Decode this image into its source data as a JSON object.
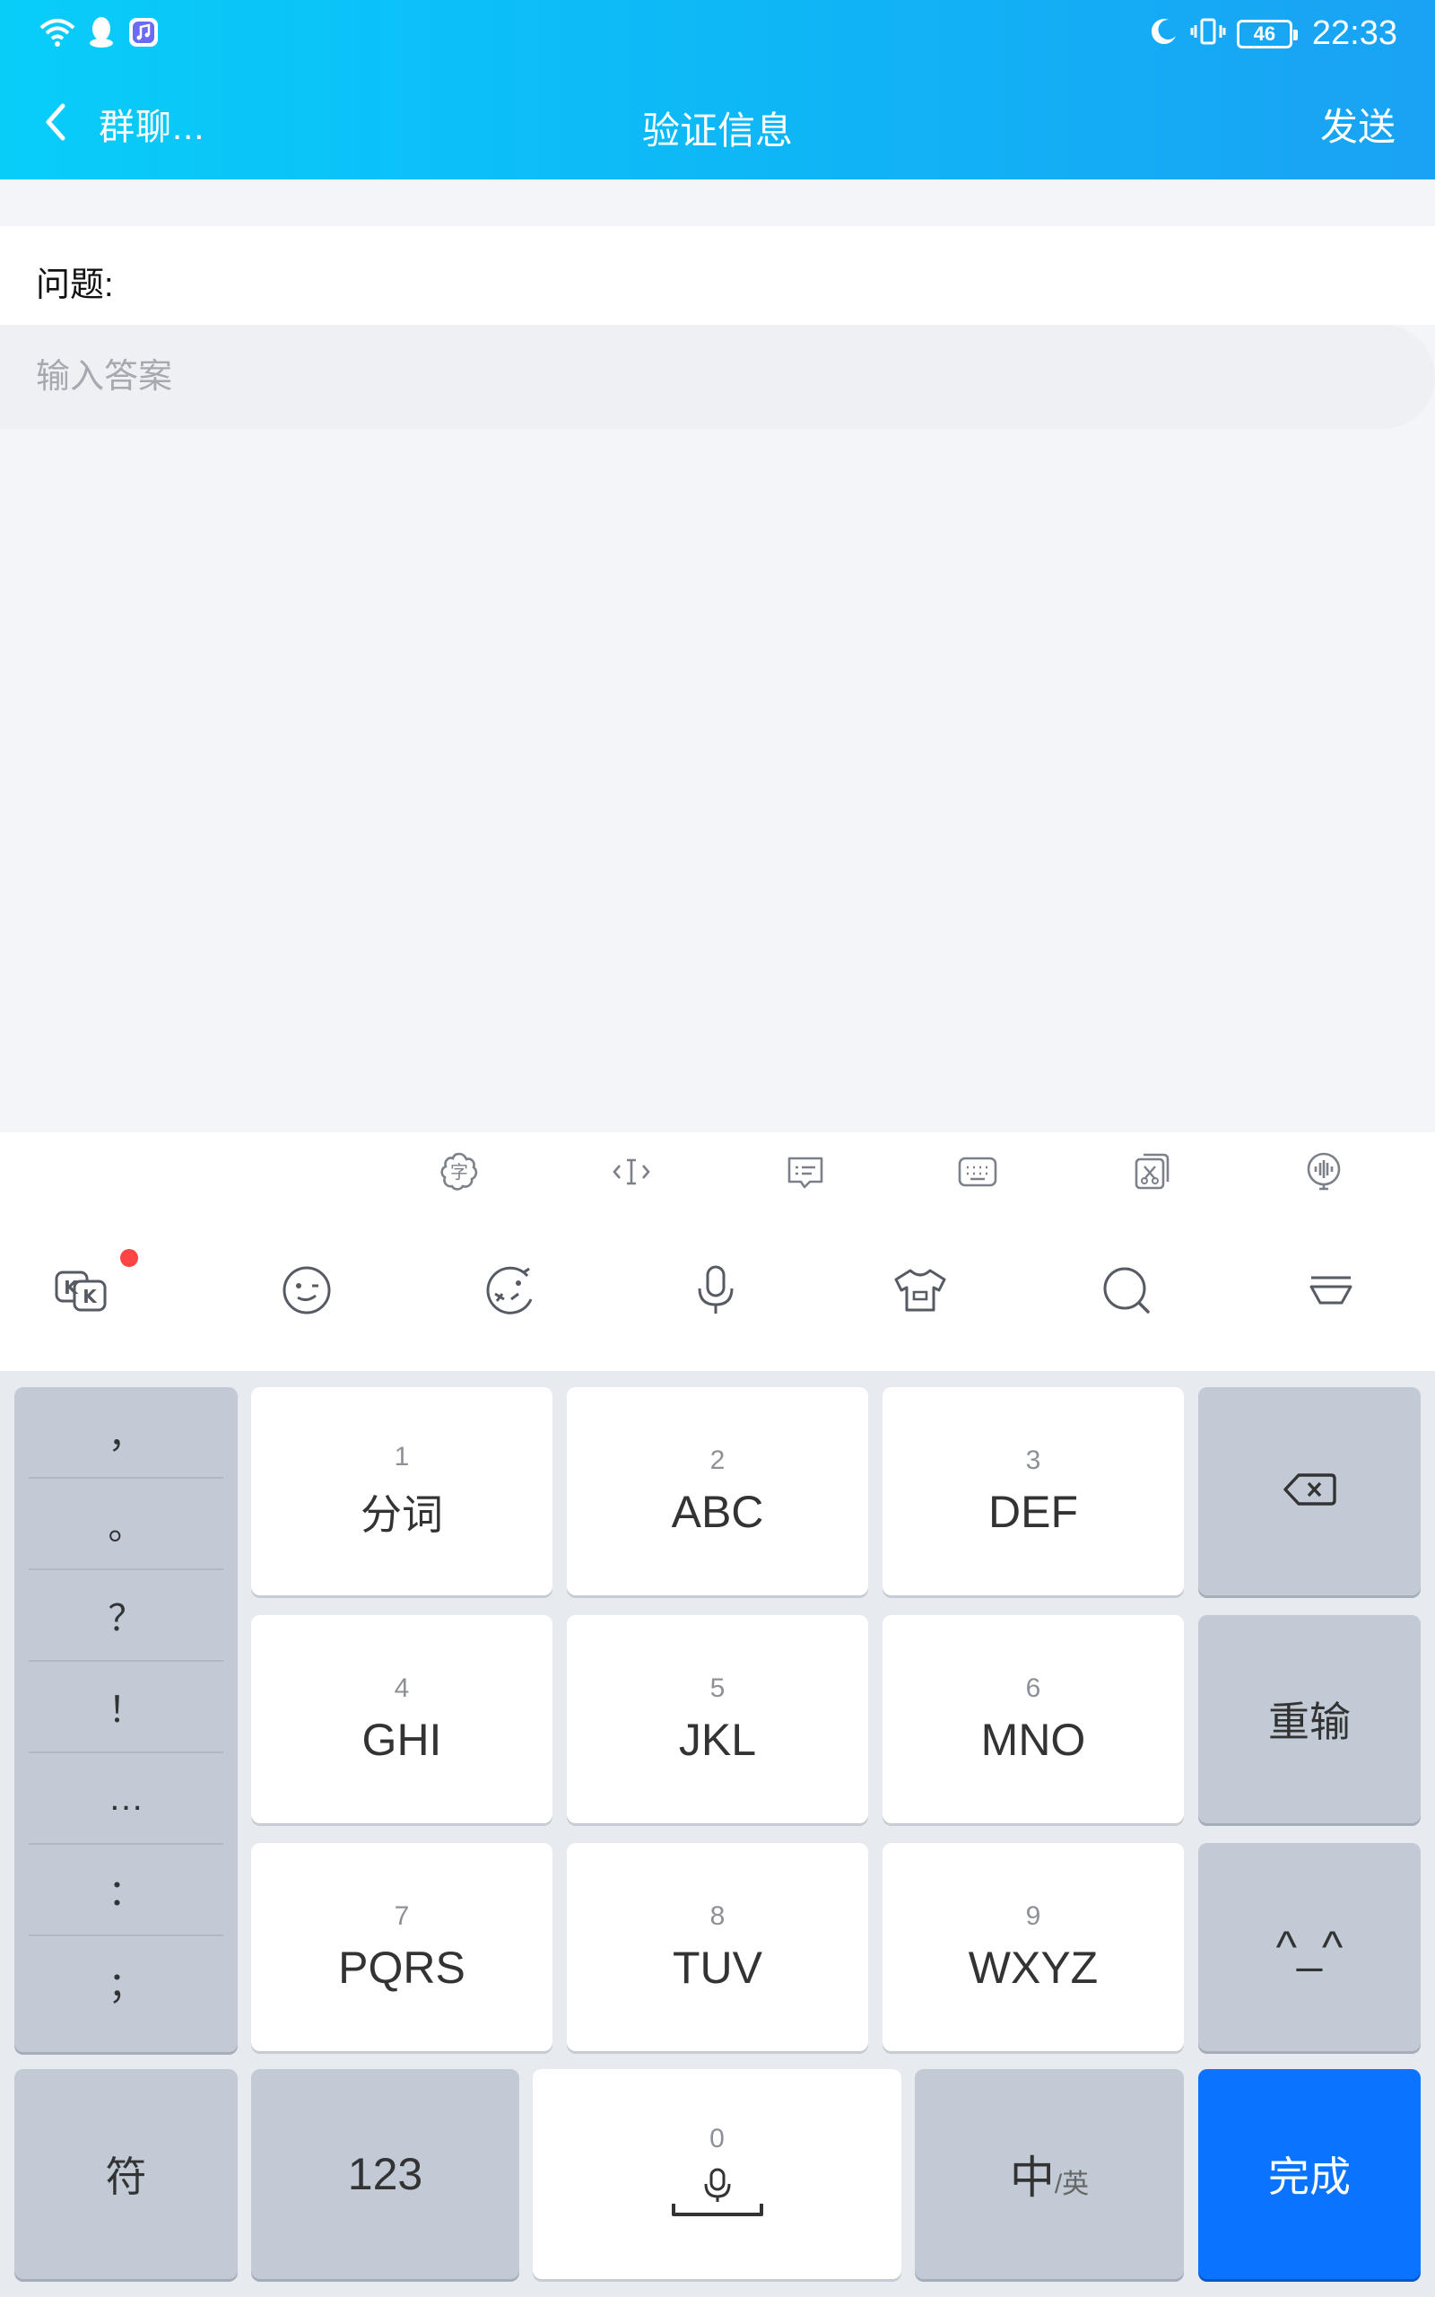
{
  "statusbar": {
    "icons_left": [
      "wifi-icon",
      "qq-icon",
      "music-app-icon"
    ],
    "icons_right": [
      "moon-icon",
      "vibrate-icon"
    ],
    "battery": "46",
    "time": "22:33"
  },
  "navbar": {
    "back_label": "群聊...",
    "title": "验证信息",
    "send_label": "发送"
  },
  "form": {
    "question_label": "问题:",
    "answer_placeholder": "输入答案",
    "answer_value": ""
  },
  "keyboard": {
    "toolbar_top": [
      "flower-char-icon",
      "text-cursor-icon",
      "clipboard-list-icon",
      "keyboard-icon",
      "scissors-icon",
      "voice-globe-icon"
    ],
    "toolbar_bottom": [
      "kk-logo-icon",
      "emoji-icon",
      "pacman-emoji-icon",
      "microphone-icon",
      "tshirt-skin-icon",
      "search-icon",
      "hide-keyboard-icon"
    ],
    "punctuation": [
      "，",
      "。",
      "？",
      "！",
      "…",
      "：",
      "；"
    ],
    "keys": [
      {
        "num": "1",
        "label": "分词"
      },
      {
        "num": "2",
        "label": "ABC"
      },
      {
        "num": "3",
        "label": "DEF"
      },
      {
        "num": "4",
        "label": "GHI"
      },
      {
        "num": "5",
        "label": "JKL"
      },
      {
        "num": "6",
        "label": "MNO"
      },
      {
        "num": "7",
        "label": "PQRS"
      },
      {
        "num": "8",
        "label": "TUV"
      },
      {
        "num": "9",
        "label": "WXYZ"
      }
    ],
    "reinput_label": "重输",
    "emoticon_label": "^_^",
    "symbol_label": "符",
    "numeric_label": "123",
    "zero_label": "0",
    "lang_main": "中",
    "lang_alt": "/英",
    "done_label": "完成"
  },
  "colors": {
    "header_gradient_start": "#08cdf9",
    "header_gradient_end": "#1aa2f4",
    "done_blue": "#0a73ff",
    "notification_red": "#ff4444"
  }
}
